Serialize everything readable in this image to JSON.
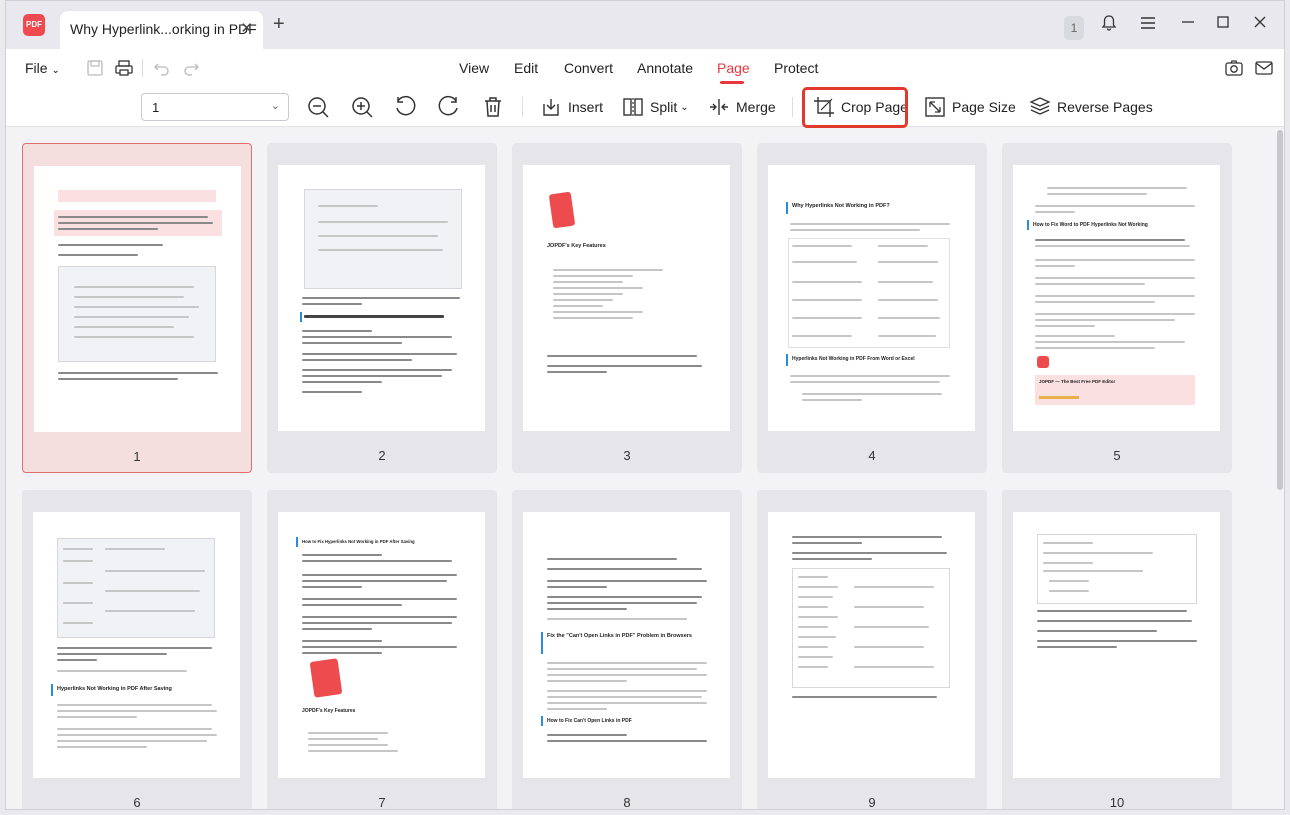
{
  "app": {
    "logo_text": "PDF",
    "tab_title": "Why Hyperlink...orking in PDF",
    "notification_count": "1"
  },
  "menubar": {
    "file_label": "File",
    "menus": [
      "View",
      "Edit",
      "Convert",
      "Annotate",
      "Page",
      "Protect"
    ],
    "active_menu": "Page"
  },
  "toolbar": {
    "page_select_value": "1",
    "insert_label": "Insert",
    "split_label": "Split",
    "merge_label": "Merge",
    "crop_page_label": "Crop Page",
    "page_size_label": "Page Size",
    "reverse_pages_label": "Reverse Pages"
  },
  "pages": {
    "p1": "1",
    "p2": "2",
    "p3": "3",
    "p4": "4",
    "p5": "5",
    "p6": "6",
    "p7": "7",
    "p8": "8",
    "p9": "9",
    "p10": "10"
  },
  "page_texts": {
    "p3_heading": "JOPDF's Key Features",
    "p4_heading": "Why Hyperlinks Not Working in PDF?",
    "p4_heading2": "Hyperlinks Not Working in PDF From Word or Excel",
    "p5_heading": "How to Fix Word to PDF Hyperlinks Not Working",
    "p5_card": "JOPDF — The Best Free PDF Editor",
    "p6_heading": "Hyperlinks Not Working in PDF After Saving",
    "p7_heading": "How to Fix Hyperlinks Not Working in PDF After Saving",
    "p7_heading2": "JOPDF's Key Features",
    "p8_heading": "Fix the \"Can't Open Links in PDF\" Problem in Browsers",
    "p8_heading2": "How to Fix Can't Open Links in PDF"
  },
  "colors": {
    "accent": "#e8383d",
    "highlight_border": "#e13a2c",
    "selected_card": "#f5dede"
  }
}
